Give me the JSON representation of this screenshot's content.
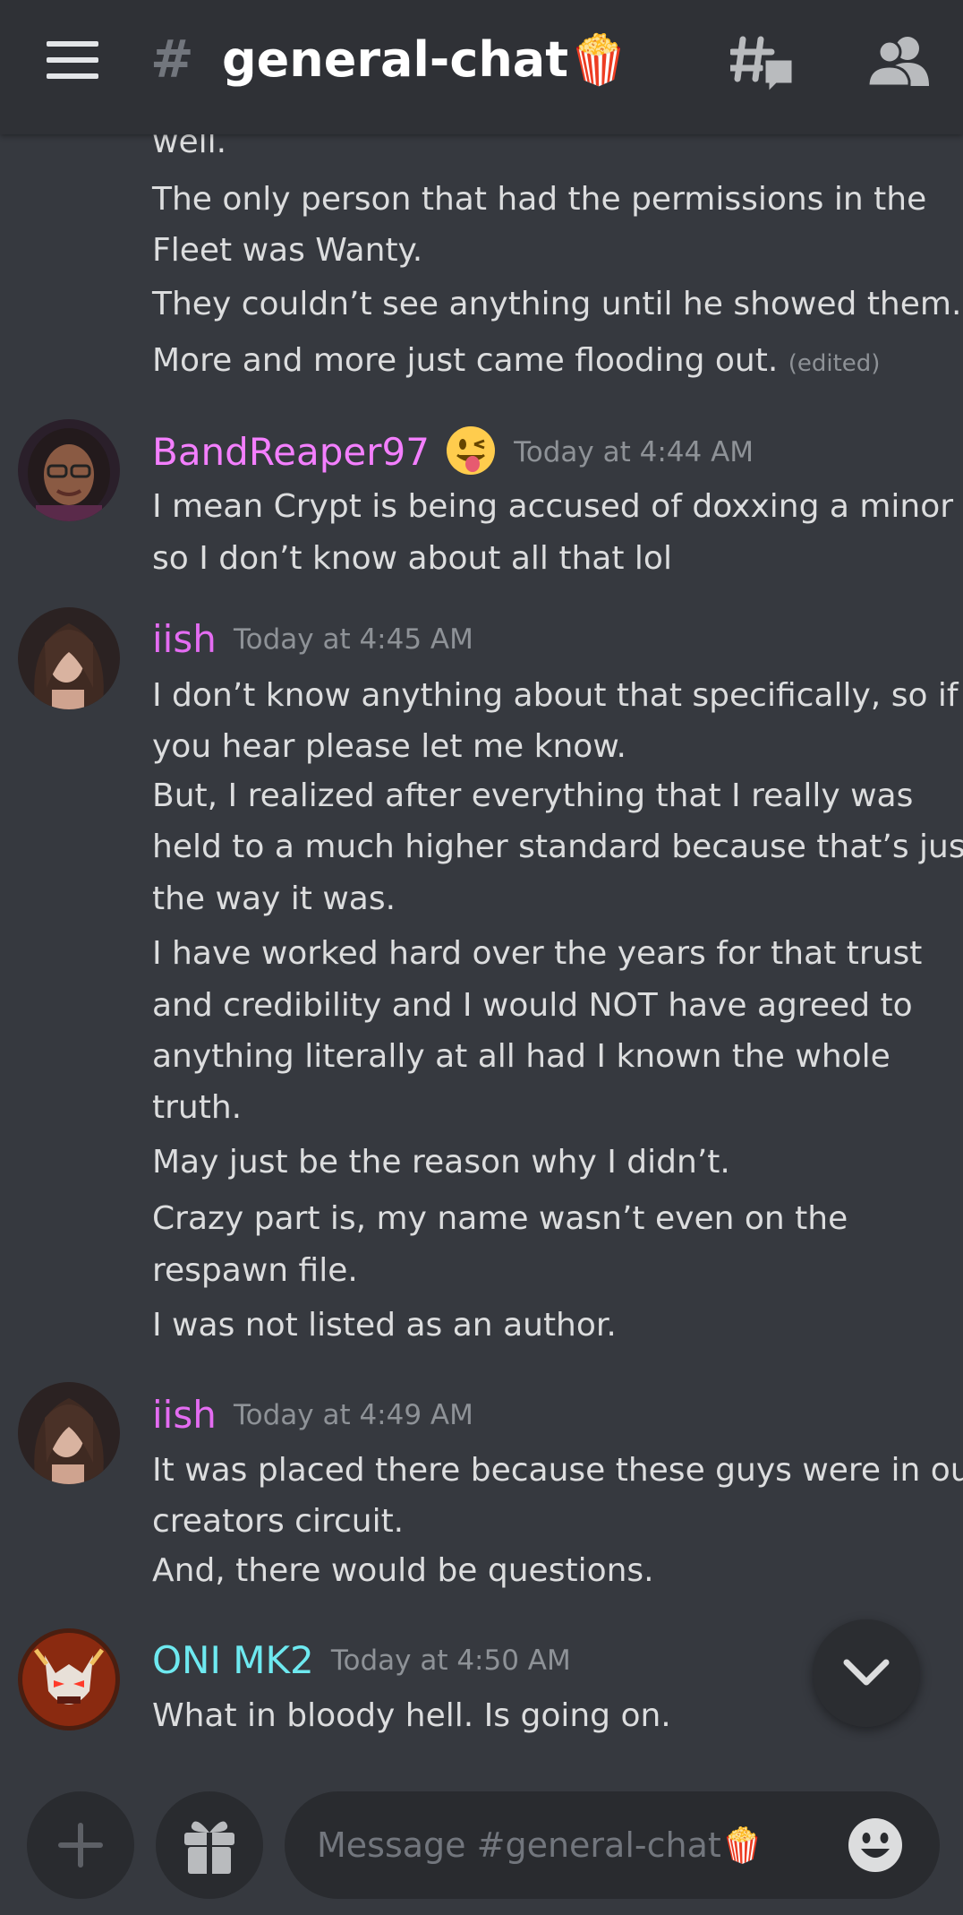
{
  "header": {
    "title": "general-chat",
    "title_suffix": "🍿",
    "hash": "#"
  },
  "icons": {
    "menu": "hamburger-menu-icon",
    "hash": "hash-icon",
    "threads": "threads-icon",
    "members": "members-icon",
    "scroll_down": "chevron-down-icon",
    "add": "plus-icon",
    "gift": "gift-icon",
    "emoji": "smiley-icon"
  },
  "colors": {
    "background": "#36393f",
    "header": "#2f3136",
    "text": "#dcddde",
    "timestamp": "#8e9297",
    "bandreaper": "#f47fff",
    "iish": "#e46cf2",
    "oni": "#6ee9f0"
  },
  "messages": [
    {
      "continued": true,
      "lines": [
        "well.",
        "The only person that had the permissions in the",
        "Fleet was Wanty.",
        "They couldn’t see anything until he showed them.",
        "More and more just came flooding out."
      ],
      "edited": "(edited)"
    },
    {
      "author": "BandReaper97",
      "author_emoji": "😜",
      "time": "Today at 4:44 AM",
      "lines": [
        "I mean Crypt is being accused of doxxing a minor",
        "so I don’t know about all that lol"
      ]
    },
    {
      "author": "iish",
      "time": "Today at 4:45 AM",
      "lines": [
        "I don’t know anything about that specifically, so if",
        "you hear please let me know.",
        "But, I realized after everything that I really was",
        "held to a much higher standard because that’s just",
        "the way it was.",
        "I have worked hard over the years for that trust",
        "and credibility and I would NOT have agreed to",
        "anything literally at all had I known the whole",
        "truth.",
        "May just be the reason why I didn’t.",
        "Crazy part is, my name wasn’t even on the",
        "respawn file.",
        "I was not listed as an author."
      ]
    },
    {
      "author": "iish",
      "time": "Today at 4:49 AM",
      "lines": [
        "It was placed there because these guys were in our",
        "creators circuit.",
        "And, there would be questions."
      ]
    },
    {
      "author": "ONI MK2",
      "time": "Today at 4:50 AM",
      "lines": [
        "What in bloody hell. Is going on."
      ]
    }
  ],
  "composer": {
    "placeholder": "Message #general-chat🍿"
  }
}
